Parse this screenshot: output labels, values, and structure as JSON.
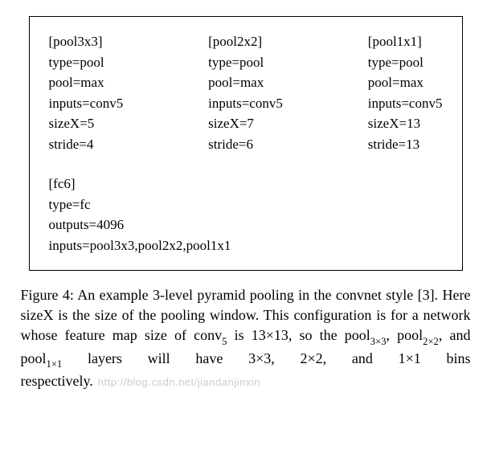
{
  "pools": [
    {
      "header": "[pool3x3]",
      "type": "type=pool",
      "pool": "pool=max",
      "inputs": "inputs=conv5",
      "sizeX": "sizeX=5",
      "stride": "stride=4"
    },
    {
      "header": "[pool2x2]",
      "type": "type=pool",
      "pool": "pool=max",
      "inputs": "inputs=conv5",
      "sizeX": "sizeX=7",
      "stride": "stride=6"
    },
    {
      "header": "[pool1x1]",
      "type": "type=pool",
      "pool": "pool=max",
      "inputs": "inputs=conv5",
      "sizeX": "sizeX=13",
      "stride": "stride=13"
    }
  ],
  "fc": {
    "header": "[fc6]",
    "type": "type=fc",
    "outputs": "outputs=4096",
    "inputs": "inputs=pool3x3,pool2x2,pool1x1"
  },
  "caption": {
    "prefix": "Figure 4: An example 3-level pyramid pooling in the convnet style [3]. Here sizeX is the size of the pooling window. This configuration is for a network whose feature map size of conv",
    "conv_sub": "5",
    "mid1": " is 13×13, so the pool",
    "p33": "3×3",
    "mid2": ", pool",
    "p22": "2×2",
    "mid3": ", and pool",
    "p11": "1×1",
    "mid4": " layers will have 3×3, 2×2, and 1×1 bins respectively.",
    "watermark": "http://blog.csdn.net/jiandanjinxin"
  }
}
